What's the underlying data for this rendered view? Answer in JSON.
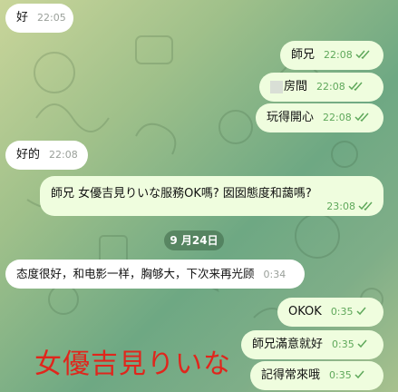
{
  "messages": [
    {
      "text": "好",
      "time": "22:05",
      "dir": "in"
    },
    {
      "text": "師兄",
      "time": "22:08",
      "dir": "out",
      "status": "read"
    },
    {
      "text": "房間",
      "time": "22:08",
      "dir": "out",
      "status": "read",
      "redacted_prefix": true
    },
    {
      "text": "玩得開心",
      "time": "22:08",
      "dir": "out",
      "status": "read"
    },
    {
      "text": "好的",
      "time": "22:08",
      "dir": "in"
    },
    {
      "text": "師兄 女優吉見りいな服務OK嗎? 囡囡態度和藹嗎?",
      "time": "23:08",
      "dir": "out",
      "status": "read"
    },
    {
      "text": "态度很好，和电影一样，胸够大，下次来再光顾",
      "time": "0:34",
      "dir": "in"
    },
    {
      "text": "OKOK",
      "time": "0:35",
      "dir": "out",
      "status": "sent"
    },
    {
      "text": "師兄滿意就好",
      "time": "0:35",
      "dir": "out",
      "status": "sent"
    },
    {
      "text": "記得常來哦",
      "time": "0:35",
      "dir": "out",
      "status": "sent"
    }
  ],
  "date_separator": "9 月24日",
  "watermark_text": "女優吉見りいな",
  "colors": {
    "outgoing_bubble": "#effdde",
    "incoming_bubble": "#ffffff",
    "check": "#5fa85b",
    "watermark": "#e0261c"
  },
  "icons": {
    "read": "double-check-icon",
    "sent": "single-check-icon"
  }
}
